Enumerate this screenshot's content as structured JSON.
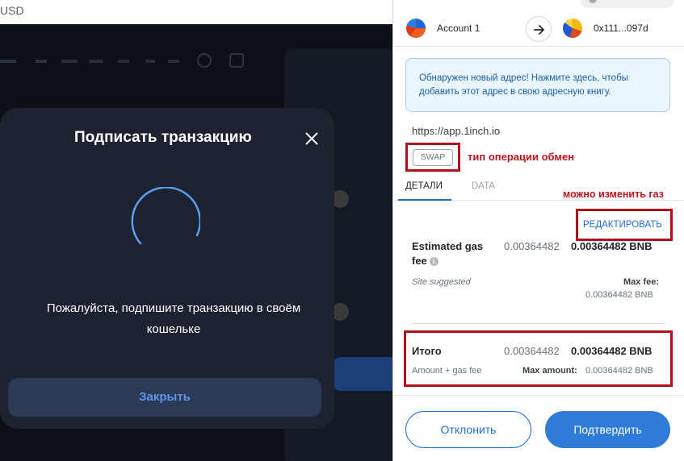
{
  "browser": {
    "currency_fragment": "USD"
  },
  "dapp_modal": {
    "title": "Подписать транзакцию",
    "message": "Пожалуйста, подпишите транзакцию в своём кошельке",
    "close_button": "Закрыть",
    "close_icon": "close-icon",
    "spinner_icon": "loading-spinner-icon"
  },
  "wallet": {
    "from_account": "Account 1",
    "to_address": "0x111...097d",
    "arrow_icon": "arrow-right-icon",
    "new_address_notice": "Обнаружен новый адрес! Нажмите здесь, чтобы добавить этот адрес в свою адресную книгу.",
    "origin": "https://app.1inch.io",
    "operation_chip": "SWAP",
    "tabs": [
      {
        "label": "ДЕТАЛИ",
        "active": true
      },
      {
        "label": "DATA",
        "active": false
      }
    ],
    "edit_link": "РЕДАКТИРОВАТЬ",
    "gas": {
      "label": "Estimated gas fee",
      "info_icon": "info-icon",
      "value_fiat_style": "0.00364482",
      "value": "0.00364482 BNB",
      "note": "Site suggested",
      "max_fee_label": "Max fee:",
      "max_fee_value": "0.00364482 BNB"
    },
    "total": {
      "label": "Итого",
      "value_light": "0.00364482",
      "value": "0.00364482 BNB",
      "note": "Amount + gas fee",
      "max_amount_label": "Max amount:",
      "max_amount_value": "0.00364482 BNB"
    },
    "reject_button": "Отклонить",
    "confirm_button": "Подтвердить"
  },
  "annotations": {
    "operation_type": "тип операции обмен",
    "gas_editable": "можно изменить газ"
  },
  "colors": {
    "annotation_red": "#c1121c",
    "metamask_blue": "#1d6fd6",
    "modal_bg": "#1c2230"
  }
}
